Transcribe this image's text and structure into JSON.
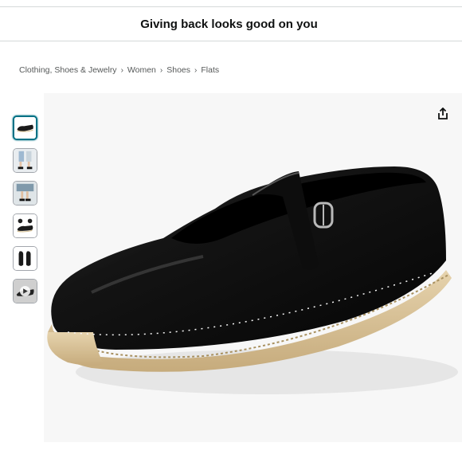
{
  "banner": {
    "text": "Giving back looks good on you"
  },
  "breadcrumb": [
    "Clothing, Shoes & Jewelry",
    "Women",
    "Shoes",
    "Flats"
  ],
  "breadcrumb_separator": "›",
  "thumbnails": [
    {
      "icon": "black-flat-shoe-thumbnail",
      "selected": true
    },
    {
      "icon": "model-wearing-shoes-thumbnail",
      "selected": false
    },
    {
      "icon": "model-legs-shoes-thumbnail",
      "selected": false
    },
    {
      "icon": "shoe-details-thumbnail",
      "selected": false
    },
    {
      "icon": "shoe-pair-thumbnail",
      "selected": false
    },
    {
      "icon": "video-thumbnail",
      "selected": false
    }
  ],
  "main_image": {
    "subject": "black leather mary-jane espadrille flat"
  },
  "colors": {
    "link": "#007185",
    "text": "#0f1111",
    "muted": "#565959"
  }
}
